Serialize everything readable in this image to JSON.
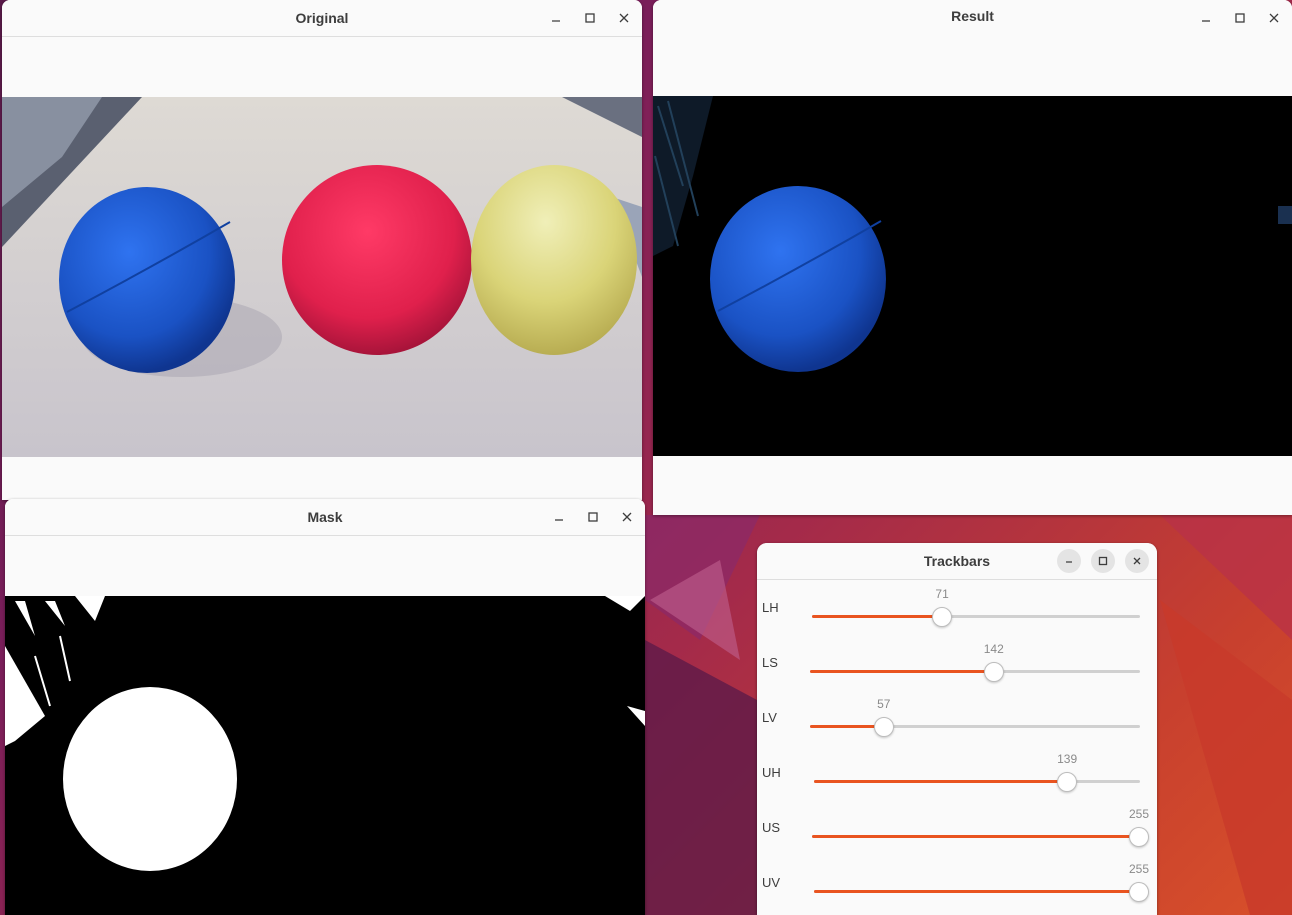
{
  "windows": {
    "original": {
      "title": "Original"
    },
    "result": {
      "title": "Result"
    },
    "mask": {
      "title": "Mask"
    },
    "trackbars": {
      "title": "Trackbars",
      "sliders": [
        {
          "label": "LH",
          "value": "71",
          "max": 179
        },
        {
          "label": "LS",
          "value": "142",
          "max": 255
        },
        {
          "label": "LV",
          "value": "57",
          "max": 255
        },
        {
          "label": "UH",
          "value": "139",
          "max": 179
        },
        {
          "label": "US",
          "value": "255",
          "max": 255
        },
        {
          "label": "UV",
          "value": "255",
          "max": 255
        }
      ]
    }
  },
  "colors": {
    "accent": "#e95420",
    "blue_ball": "#1a55c8",
    "red_ball": "#e8234f",
    "yellow_ball": "#dcd67a",
    "table": "#d6d2cc"
  },
  "icons": {
    "minimize": "minimize-icon",
    "maximize": "maximize-icon",
    "close": "close-icon"
  }
}
